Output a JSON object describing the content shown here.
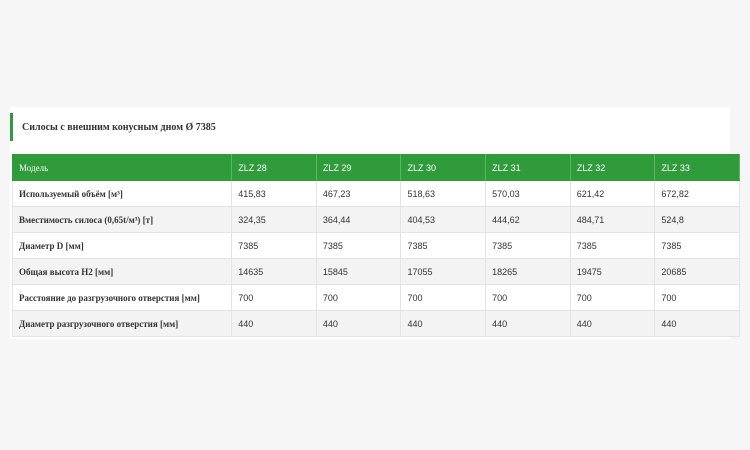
{
  "section_title": "Силосы с внешним конусным дном Ø 7385",
  "table": {
    "header": [
      "Модель",
      "ZLZ 28",
      "ZLZ 29",
      "ZLZ 30",
      "ZLZ 31",
      "ZLZ 32",
      "ZLZ 33"
    ],
    "rows": [
      {
        "label": "Используемый объём [м³]",
        "values": [
          "415,83",
          "467,23",
          "518,63",
          "570,03",
          "621,42",
          "672,82"
        ]
      },
      {
        "label": "Вместимость силоса (0,65t/м³) [т]",
        "values": [
          "324,35",
          "364,44",
          "404,53",
          "444,62",
          "484,71",
          "524,8"
        ]
      },
      {
        "label": "Диаметр D [мм]",
        "values": [
          "7385",
          "7385",
          "7385",
          "7385",
          "7385",
          "7385"
        ]
      },
      {
        "label": "Общая высота H2 [мм]",
        "values": [
          "14635",
          "15845",
          "17055",
          "18265",
          "19475",
          "20685"
        ]
      },
      {
        "label": "Расстояние до разгрузочного отверстия [мм]",
        "values": [
          "700",
          "700",
          "700",
          "700",
          "700",
          "700"
        ]
      },
      {
        "label": "Диаметр разгрузочного отверстия [мм]",
        "values": [
          "440",
          "440",
          "440",
          "440",
          "440",
          "440"
        ]
      }
    ]
  },
  "colors": {
    "accent": "#2f9b3a",
    "header_text": "#ffffff",
    "body_text": "#333333"
  }
}
